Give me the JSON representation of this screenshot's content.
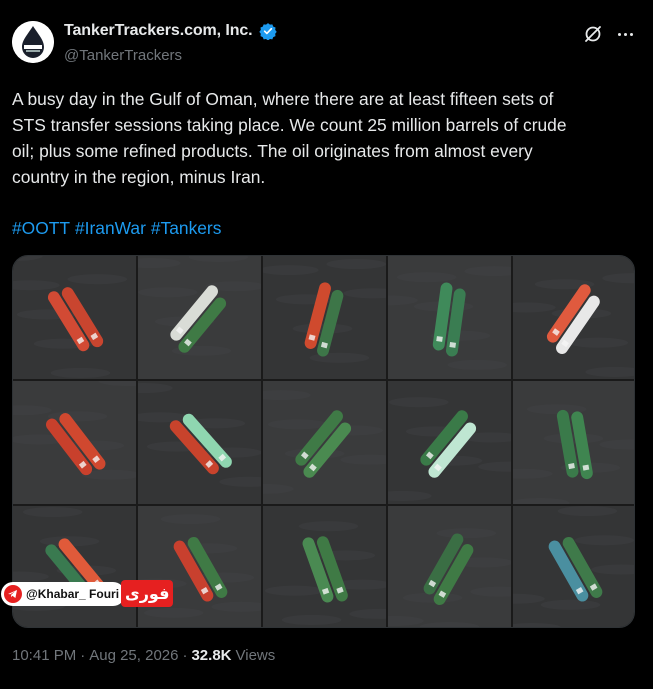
{
  "account": {
    "display_name": "TankerTrackers.com, Inc.",
    "handle": "@TankerTrackers",
    "verified": true,
    "avatar_icon": "droplet-logo-icon"
  },
  "tweet": {
    "text": "A busy day in the Gulf of Oman, where there are at least fifteen sets of\nSTS transfer sessions taking place. We count 25 million barrels of crude\noil; plus some refined products. The oil originates from almost every\ncountry in the region, minus Iran.",
    "hashtags": [
      "#OOTT",
      "#IranWar",
      "#Tankers"
    ]
  },
  "media": {
    "layout": "5x3 satellite image grid of tanker pairs",
    "tiles": [
      {
        "colors": [
          "#d24a34",
          "#c9452f"
        ]
      },
      {
        "colors": [
          "#d9dcd6",
          "#3f7a45"
        ]
      },
      {
        "colors": [
          "#cf4a2e",
          "#3d7648"
        ]
      },
      {
        "colors": [
          "#3f8a5a",
          "#3a7d52"
        ]
      },
      {
        "colors": [
          "#e05a3e",
          "#e8e8e8"
        ]
      },
      {
        "colors": [
          "#c8402c",
          "#d0482f"
        ]
      },
      {
        "colors": [
          "#c8432c",
          "#8fd6b0"
        ]
      },
      {
        "colors": [
          "#3f7a46",
          "#4a8a50"
        ]
      },
      {
        "colors": [
          "#3a7a48",
          "#bfe6d2"
        ]
      },
      {
        "colors": [
          "#3a7a4a",
          "#3f8550"
        ]
      },
      {
        "colors": [
          "#3a7a50",
          "#e05a3a"
        ]
      },
      {
        "colors": [
          "#c8402e",
          "#3f7a45"
        ]
      },
      {
        "colors": [
          "#4a8a52",
          "#3f7a45"
        ]
      },
      {
        "colors": [
          "#3a6e44",
          "#3f7a45"
        ]
      },
      {
        "colors": [
          "#4a8fa0",
          "#3f7a4a"
        ]
      }
    ],
    "watermark": {
      "handle": "@Khabar_ Fouri",
      "logo_text": "فوری"
    }
  },
  "meta": {
    "time": "10:41 PM",
    "separator": "·",
    "date": "Aug 25, 2026",
    "separator2": "·",
    "views_count": "32.8K",
    "views_label": "Views"
  },
  "colors": {
    "background": "#000000",
    "text": "#e7e9ea",
    "muted": "#71767b",
    "link": "#1d9bf0",
    "verified": "#1d9bf0"
  }
}
